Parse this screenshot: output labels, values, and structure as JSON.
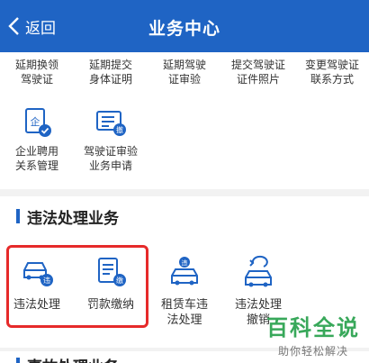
{
  "header": {
    "back_label": "返回",
    "title": "业务中心"
  },
  "top_items": [
    {
      "label_line1": "延期换领",
      "label_line2": "驾驶证"
    },
    {
      "label_line1": "延期提交",
      "label_line2": "身体证明"
    },
    {
      "label_line1": "延期驾驶",
      "label_line2": "证审验"
    },
    {
      "label_line1": "提交驾驶证",
      "label_line2": "证件照片"
    },
    {
      "label_line1": "变更驾驶证",
      "label_line2": "联系方式"
    },
    {
      "label_line1": "企业聘用",
      "label_line2": "关系管理",
      "icon_text": "企"
    },
    {
      "label_line1": "驾驶证审验",
      "label_line2": "业务申请",
      "icon_text": "撤"
    }
  ],
  "section": {
    "title": "违法处理业务"
  },
  "biz_items": [
    {
      "label_line1": "违法处理",
      "label_line2": "",
      "badge": "违"
    },
    {
      "label_line1": "罚款缴纳",
      "label_line2": "",
      "badge": "缴"
    },
    {
      "label_line1": "租赁车违",
      "label_line2": "法处理",
      "badge": "违"
    },
    {
      "label_line1": "违法处理",
      "label_line2": "撤销",
      "badge": ""
    }
  ],
  "next_section": {
    "title": "事故处理业务"
  },
  "watermark": {
    "main": "百科全说",
    "sub": "助你轻松解决"
  },
  "colors": {
    "brand": "#1f64c4",
    "highlight": "#e62a2a",
    "watermark": "#38a85a"
  }
}
